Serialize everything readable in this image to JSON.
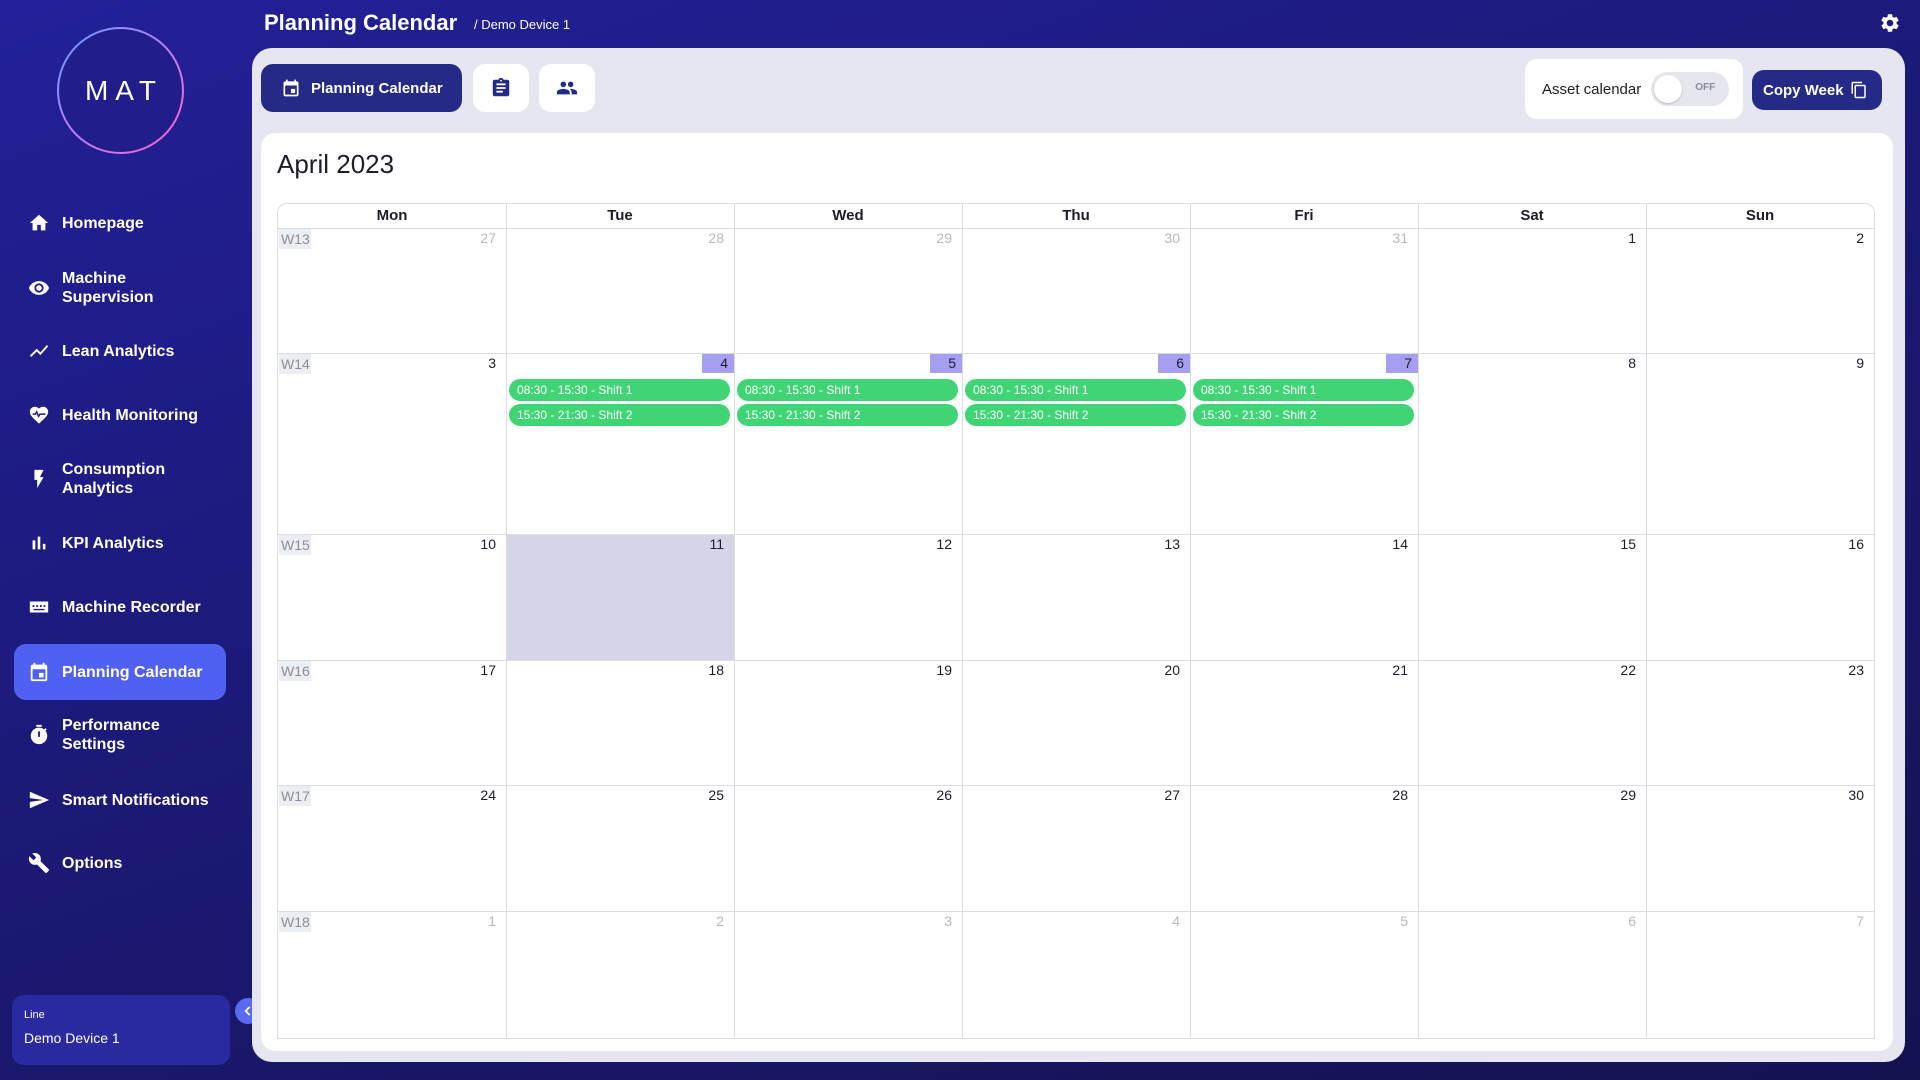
{
  "app": {
    "logo": "MAT",
    "page_title": "Planning Calendar",
    "breadcrumb": "/ Demo Device 1"
  },
  "sidebar": {
    "items": [
      {
        "label": "Homepage",
        "icon": "home-icon",
        "active": false
      },
      {
        "label": "Machine Supervision",
        "icon": "eye-icon",
        "active": false
      },
      {
        "label": "Lean Analytics",
        "icon": "trend-icon",
        "active": false
      },
      {
        "label": "Health Monitoring",
        "icon": "heart-pulse-icon",
        "active": false
      },
      {
        "label": "Consumption Analytics",
        "icon": "bolt-icon",
        "active": false
      },
      {
        "label": "KPI Analytics",
        "icon": "bar-chart-icon",
        "active": false
      },
      {
        "label": "Machine Recorder",
        "icon": "recorder-icon",
        "active": false
      },
      {
        "label": "Planning Calendar",
        "icon": "calendar-icon",
        "active": true
      },
      {
        "label": "Performance Settings",
        "icon": "stopwatch-icon",
        "active": false
      },
      {
        "label": "Smart Notifications",
        "icon": "send-icon",
        "active": false
      },
      {
        "label": "Options",
        "icon": "wrench-icon",
        "active": false
      }
    ],
    "line": {
      "label": "Line",
      "value": "Demo Device 1"
    }
  },
  "toolbar": {
    "planning_tab": "Planning Calendar",
    "asset_label": "Asset calendar",
    "toggle_state": "OFF",
    "copy_week": "Copy Week"
  },
  "calendar": {
    "month_title": "April 2023",
    "weekdays": [
      "Mon",
      "Tue",
      "Wed",
      "Thu",
      "Fri",
      "Sat",
      "Sun"
    ],
    "weeks": [
      {
        "label": "W13",
        "days": [
          {
            "n": "27",
            "muted": true
          },
          {
            "n": "28",
            "muted": true
          },
          {
            "n": "29",
            "muted": true
          },
          {
            "n": "30",
            "muted": true
          },
          {
            "n": "31",
            "muted": true
          },
          {
            "n": "1"
          },
          {
            "n": "2"
          }
        ]
      },
      {
        "label": "W14",
        "days": [
          {
            "n": "3"
          },
          {
            "n": "4",
            "hl": true,
            "shifts": [
              "08:30 - 15:30 - Shift 1",
              "15:30 - 21:30 - Shift 2"
            ]
          },
          {
            "n": "5",
            "hl": true,
            "shifts": [
              "08:30 - 15:30 - Shift 1",
              "15:30 - 21:30 - Shift 2"
            ]
          },
          {
            "n": "6",
            "hl": true,
            "shifts": [
              "08:30 - 15:30 - Shift 1",
              "15:30 - 21:30 - Shift 2"
            ]
          },
          {
            "n": "7",
            "hl": true,
            "shifts": [
              "08:30 - 15:30 - Shift 1",
              "15:30 - 21:30 - Shift 2"
            ]
          },
          {
            "n": "8"
          },
          {
            "n": "9"
          }
        ]
      },
      {
        "label": "W15",
        "days": [
          {
            "n": "10"
          },
          {
            "n": "11",
            "today": true
          },
          {
            "n": "12"
          },
          {
            "n": "13"
          },
          {
            "n": "14"
          },
          {
            "n": "15"
          },
          {
            "n": "16"
          }
        ]
      },
      {
        "label": "W16",
        "days": [
          {
            "n": "17"
          },
          {
            "n": "18"
          },
          {
            "n": "19"
          },
          {
            "n": "20"
          },
          {
            "n": "21"
          },
          {
            "n": "22"
          },
          {
            "n": "23"
          }
        ]
      },
      {
        "label": "W17",
        "days": [
          {
            "n": "24"
          },
          {
            "n": "25"
          },
          {
            "n": "26"
          },
          {
            "n": "27"
          },
          {
            "n": "28"
          },
          {
            "n": "29"
          },
          {
            "n": "30"
          }
        ]
      },
      {
        "label": "W18",
        "days": [
          {
            "n": "1",
            "muted": true
          },
          {
            "n": "2",
            "muted": true
          },
          {
            "n": "3",
            "muted": true
          },
          {
            "n": "4",
            "muted": true
          },
          {
            "n": "5",
            "muted": true
          },
          {
            "n": "6",
            "muted": true
          },
          {
            "n": "7",
            "muted": true
          }
        ]
      }
    ]
  },
  "colors": {
    "accent": "#5060f0",
    "dark": "#242a86",
    "shift": "#40d475",
    "highlight": "#a69ef0",
    "today": "#d4d5e6"
  }
}
